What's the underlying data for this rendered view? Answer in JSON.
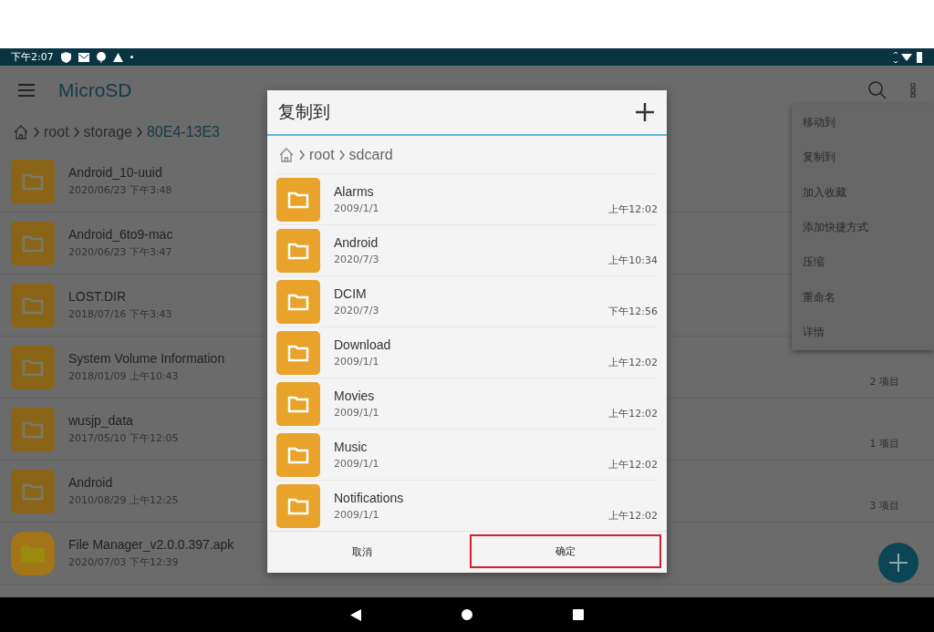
{
  "status_bar": {
    "time": "下午2:07"
  },
  "app_bar": {
    "title": "MicroSD"
  },
  "breadcrumb": [
    "root",
    "storage",
    "80E4-13E3"
  ],
  "files": [
    {
      "name": "Android_10-uuid",
      "date": "2020/06/23 下午3:48",
      "kind": "folder"
    },
    {
      "name": "Android_6to9-mac",
      "date": "2020/06/23 下午3:47",
      "kind": "folder"
    },
    {
      "name": "LOST.DIR",
      "date": "2018/07/16 下午3:43",
      "kind": "folder"
    },
    {
      "name": "System Volume Information",
      "date": "2018/01/09 上午10:43",
      "count": "2 项目",
      "kind": "folder"
    },
    {
      "name": "wusjp_data",
      "date": "2017/05/10 下午12:05",
      "count": "1 项目",
      "kind": "folder"
    },
    {
      "name": "Android",
      "date": "2010/08/29 上午12:25",
      "count": "3 项目",
      "kind": "folder"
    },
    {
      "name": "File Manager_v2.0.0.397.apk",
      "date": "2020/07/03 下午12:39",
      "kind": "apk"
    }
  ],
  "menu": [
    "移动到",
    "复制到",
    "加入收藏",
    "添加快捷方式",
    "压缩",
    "重命名",
    "详情"
  ],
  "dialog": {
    "title": "复制到",
    "breadcrumb": [
      "root",
      "sdcard"
    ],
    "folders": [
      {
        "name": "Alarms",
        "date": "2009/1/1",
        "time": "上午12:02"
      },
      {
        "name": "Android",
        "date": "2020/7/3",
        "time": "上午10:34"
      },
      {
        "name": "DCIM",
        "date": "2020/7/3",
        "time": "下午12:56"
      },
      {
        "name": "Download",
        "date": "2009/1/1",
        "time": "上午12:02"
      },
      {
        "name": "Movies",
        "date": "2009/1/1",
        "time": "上午12:02"
      },
      {
        "name": "Music",
        "date": "2009/1/1",
        "time": "上午12:02"
      },
      {
        "name": "Notifications",
        "date": "2009/1/1",
        "time": "上午12:02"
      }
    ],
    "buttons": [
      {
        "label": "取消",
        "highlighted": false
      },
      {
        "label": "确定",
        "highlighted": true
      }
    ]
  }
}
